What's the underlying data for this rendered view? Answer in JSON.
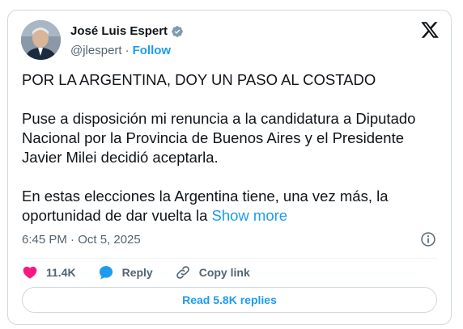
{
  "author": {
    "name": "José Luis Espert",
    "handle": "@jlespert",
    "separator": "·",
    "follow_label": "Follow"
  },
  "tweet": {
    "paragraphs": [
      "POR LA ARGENTINA, DOY UN PASO AL COSTADO",
      "Puse a disposición mi renuncia a la candidatura a Diputado Nacional por la Provincia de Buenos Aires y el Presidente Javier Milei decidió aceptarla.",
      "En estas elecciones la Argentina tiene, una vez más, la oportunidad de dar vuelta la"
    ],
    "show_more_label": "Show more",
    "timestamp": "6:45 PM · Oct 5, 2025"
  },
  "actions": {
    "likes": "11.4K",
    "reply_label": "Reply",
    "copy_link_label": "Copy link"
  },
  "replies_button_label": "Read 5.8K replies",
  "icons": {
    "verified": "verified-badge-icon",
    "x_logo": "x-logo-icon",
    "info": "info-icon",
    "heart": "heart-icon",
    "reply": "reply-bubble-icon",
    "link": "link-icon"
  },
  "colors": {
    "accent": "#1d9bf0",
    "heart": "#f91880",
    "secondary_text": "#536471",
    "border": "#cfd9de"
  }
}
